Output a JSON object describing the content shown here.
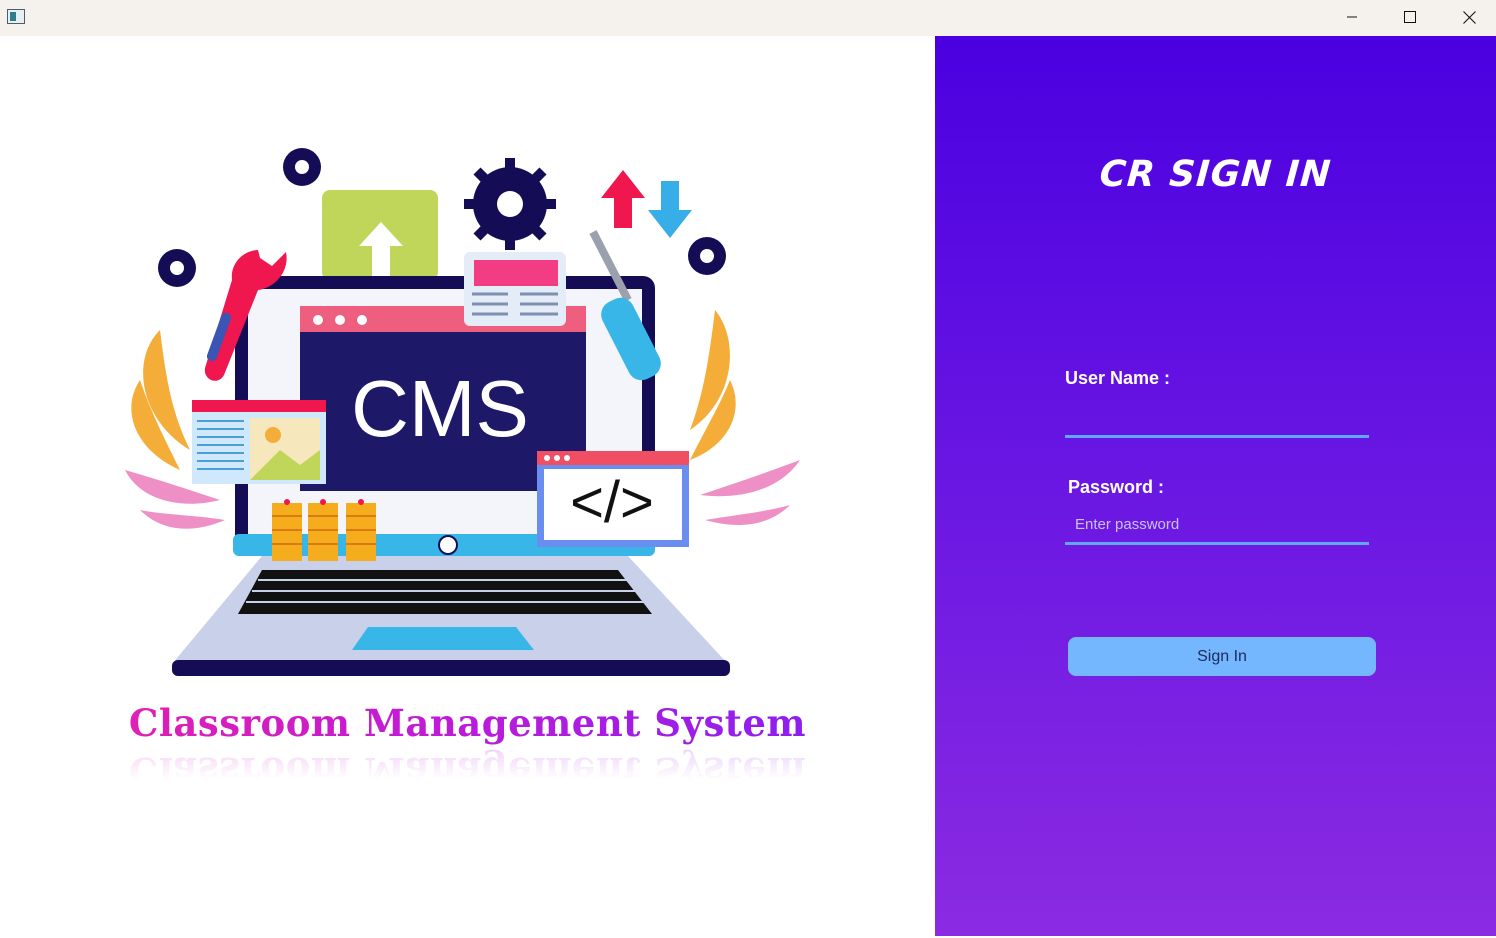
{
  "window": {
    "app_icon": "window-app-icon",
    "controls": {
      "minimize": "minimize-icon",
      "maximize": "maximize-icon",
      "close": "close-icon"
    }
  },
  "left_panel": {
    "illustration": {
      "screen_text": "CMS",
      "code_symbol": "</>"
    },
    "brand_title": "Classroom Management System"
  },
  "right_panel": {
    "title": "CR SIGN IN",
    "username": {
      "label": "User Name :",
      "value": "",
      "placeholder": ""
    },
    "password": {
      "label": "Password :",
      "value": "",
      "placeholder": "Enter password"
    },
    "signin_button": "Sign In"
  },
  "colors": {
    "panel_gradient_top": "#4a00e0",
    "panel_gradient_bottom": "#8b2be2",
    "input_underline": "#5ea9ff",
    "button_bg": "#74b7ff",
    "brand_gradient_start": "#e01fb4",
    "brand_gradient_end": "#8d1ef0"
  }
}
